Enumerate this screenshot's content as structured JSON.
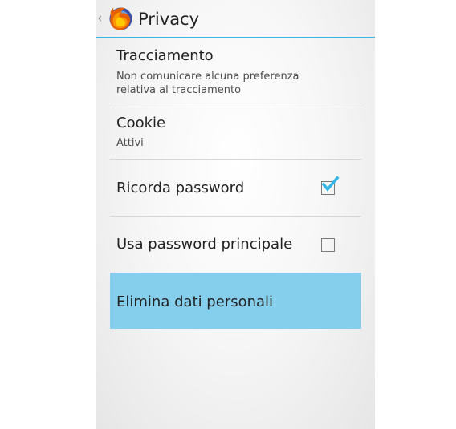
{
  "action_bar": {
    "up_glyph": "‹",
    "app_icon": "firefox-logo",
    "title": "Privacy"
  },
  "prefs": [
    {
      "title": "Tracciamento",
      "summary": "Non comunicare alcuna preferenza\nrelativa al tracciamento"
    },
    {
      "title": "Cookie",
      "summary": "Attivi"
    },
    {
      "title": "Ricorda password",
      "checked": true
    },
    {
      "title": "Usa password principale",
      "checked": false
    },
    {
      "title": "Elimina dati personali",
      "state": "pressed"
    }
  ],
  "colors": {
    "accent": "#33b5e5",
    "pressed_highlight": "#85cfec",
    "checkmark": "#33b5e5"
  }
}
